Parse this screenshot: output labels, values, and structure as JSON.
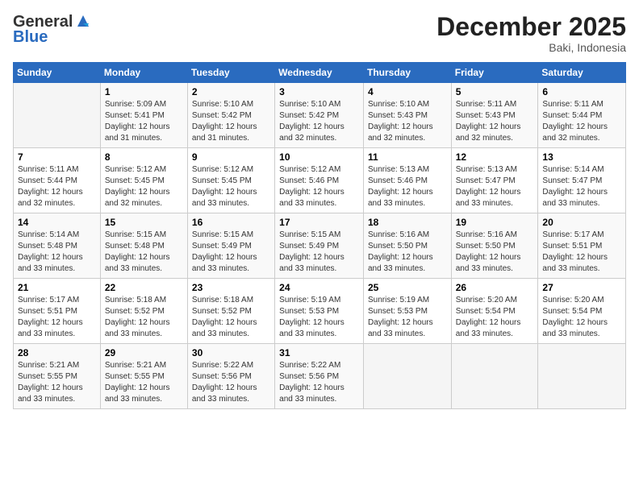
{
  "header": {
    "logo_line1": "General",
    "logo_line2": "Blue",
    "month_title": "December 2025",
    "location": "Baki, Indonesia"
  },
  "days_of_week": [
    "Sunday",
    "Monday",
    "Tuesday",
    "Wednesday",
    "Thursday",
    "Friday",
    "Saturday"
  ],
  "weeks": [
    [
      {
        "num": "",
        "info": ""
      },
      {
        "num": "1",
        "info": "Sunrise: 5:09 AM\nSunset: 5:41 PM\nDaylight: 12 hours\nand 31 minutes."
      },
      {
        "num": "2",
        "info": "Sunrise: 5:10 AM\nSunset: 5:42 PM\nDaylight: 12 hours\nand 31 minutes."
      },
      {
        "num": "3",
        "info": "Sunrise: 5:10 AM\nSunset: 5:42 PM\nDaylight: 12 hours\nand 32 minutes."
      },
      {
        "num": "4",
        "info": "Sunrise: 5:10 AM\nSunset: 5:43 PM\nDaylight: 12 hours\nand 32 minutes."
      },
      {
        "num": "5",
        "info": "Sunrise: 5:11 AM\nSunset: 5:43 PM\nDaylight: 12 hours\nand 32 minutes."
      },
      {
        "num": "6",
        "info": "Sunrise: 5:11 AM\nSunset: 5:44 PM\nDaylight: 12 hours\nand 32 minutes."
      }
    ],
    [
      {
        "num": "7",
        "info": "Sunrise: 5:11 AM\nSunset: 5:44 PM\nDaylight: 12 hours\nand 32 minutes."
      },
      {
        "num": "8",
        "info": "Sunrise: 5:12 AM\nSunset: 5:45 PM\nDaylight: 12 hours\nand 32 minutes."
      },
      {
        "num": "9",
        "info": "Sunrise: 5:12 AM\nSunset: 5:45 PM\nDaylight: 12 hours\nand 33 minutes."
      },
      {
        "num": "10",
        "info": "Sunrise: 5:12 AM\nSunset: 5:46 PM\nDaylight: 12 hours\nand 33 minutes."
      },
      {
        "num": "11",
        "info": "Sunrise: 5:13 AM\nSunset: 5:46 PM\nDaylight: 12 hours\nand 33 minutes."
      },
      {
        "num": "12",
        "info": "Sunrise: 5:13 AM\nSunset: 5:47 PM\nDaylight: 12 hours\nand 33 minutes."
      },
      {
        "num": "13",
        "info": "Sunrise: 5:14 AM\nSunset: 5:47 PM\nDaylight: 12 hours\nand 33 minutes."
      }
    ],
    [
      {
        "num": "14",
        "info": "Sunrise: 5:14 AM\nSunset: 5:48 PM\nDaylight: 12 hours\nand 33 minutes."
      },
      {
        "num": "15",
        "info": "Sunrise: 5:15 AM\nSunset: 5:48 PM\nDaylight: 12 hours\nand 33 minutes."
      },
      {
        "num": "16",
        "info": "Sunrise: 5:15 AM\nSunset: 5:49 PM\nDaylight: 12 hours\nand 33 minutes."
      },
      {
        "num": "17",
        "info": "Sunrise: 5:15 AM\nSunset: 5:49 PM\nDaylight: 12 hours\nand 33 minutes."
      },
      {
        "num": "18",
        "info": "Sunrise: 5:16 AM\nSunset: 5:50 PM\nDaylight: 12 hours\nand 33 minutes."
      },
      {
        "num": "19",
        "info": "Sunrise: 5:16 AM\nSunset: 5:50 PM\nDaylight: 12 hours\nand 33 minutes."
      },
      {
        "num": "20",
        "info": "Sunrise: 5:17 AM\nSunset: 5:51 PM\nDaylight: 12 hours\nand 33 minutes."
      }
    ],
    [
      {
        "num": "21",
        "info": "Sunrise: 5:17 AM\nSunset: 5:51 PM\nDaylight: 12 hours\nand 33 minutes."
      },
      {
        "num": "22",
        "info": "Sunrise: 5:18 AM\nSunset: 5:52 PM\nDaylight: 12 hours\nand 33 minutes."
      },
      {
        "num": "23",
        "info": "Sunrise: 5:18 AM\nSunset: 5:52 PM\nDaylight: 12 hours\nand 33 minutes."
      },
      {
        "num": "24",
        "info": "Sunrise: 5:19 AM\nSunset: 5:53 PM\nDaylight: 12 hours\nand 33 minutes."
      },
      {
        "num": "25",
        "info": "Sunrise: 5:19 AM\nSunset: 5:53 PM\nDaylight: 12 hours\nand 33 minutes."
      },
      {
        "num": "26",
        "info": "Sunrise: 5:20 AM\nSunset: 5:54 PM\nDaylight: 12 hours\nand 33 minutes."
      },
      {
        "num": "27",
        "info": "Sunrise: 5:20 AM\nSunset: 5:54 PM\nDaylight: 12 hours\nand 33 minutes."
      }
    ],
    [
      {
        "num": "28",
        "info": "Sunrise: 5:21 AM\nSunset: 5:55 PM\nDaylight: 12 hours\nand 33 minutes."
      },
      {
        "num": "29",
        "info": "Sunrise: 5:21 AM\nSunset: 5:55 PM\nDaylight: 12 hours\nand 33 minutes."
      },
      {
        "num": "30",
        "info": "Sunrise: 5:22 AM\nSunset: 5:56 PM\nDaylight: 12 hours\nand 33 minutes."
      },
      {
        "num": "31",
        "info": "Sunrise: 5:22 AM\nSunset: 5:56 PM\nDaylight: 12 hours\nand 33 minutes."
      },
      {
        "num": "",
        "info": ""
      },
      {
        "num": "",
        "info": ""
      },
      {
        "num": "",
        "info": ""
      }
    ]
  ]
}
